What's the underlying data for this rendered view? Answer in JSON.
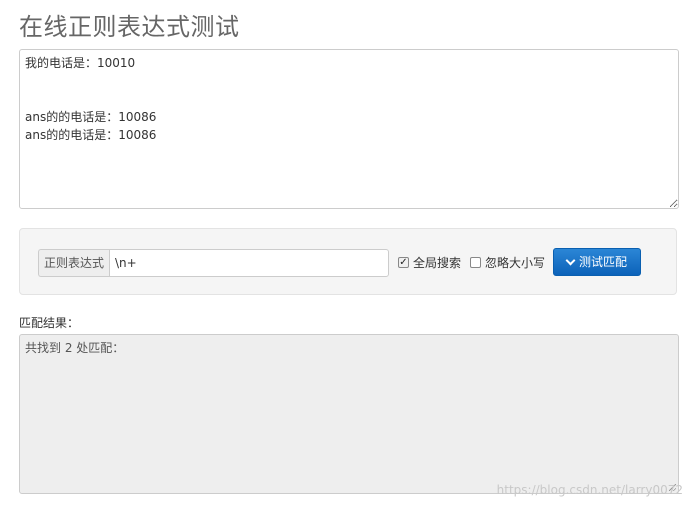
{
  "page": {
    "title": "在线正则表达式测试"
  },
  "source": {
    "text": "我的电话是：10010\n\n\nans的的电话是：10086\nans的的电话是：10086"
  },
  "controls": {
    "regex_label": "正则表达式",
    "regex_value": "\\n+",
    "global_search_label": "全局搜索",
    "global_search_checked": true,
    "ignore_case_label": "忽略大小写",
    "ignore_case_checked": false,
    "test_button_label": "测试匹配",
    "test_button_icon": "chevron-down-icon"
  },
  "result": {
    "label": "匹配结果：",
    "text": "共找到 2 处匹配："
  },
  "watermark": {
    "text": "https://blog.csdn.net/larry0072"
  },
  "colors": {
    "button_blue": "#0c62b9",
    "panel_bg": "#f5f5f5",
    "result_bg": "#eeeeee"
  }
}
